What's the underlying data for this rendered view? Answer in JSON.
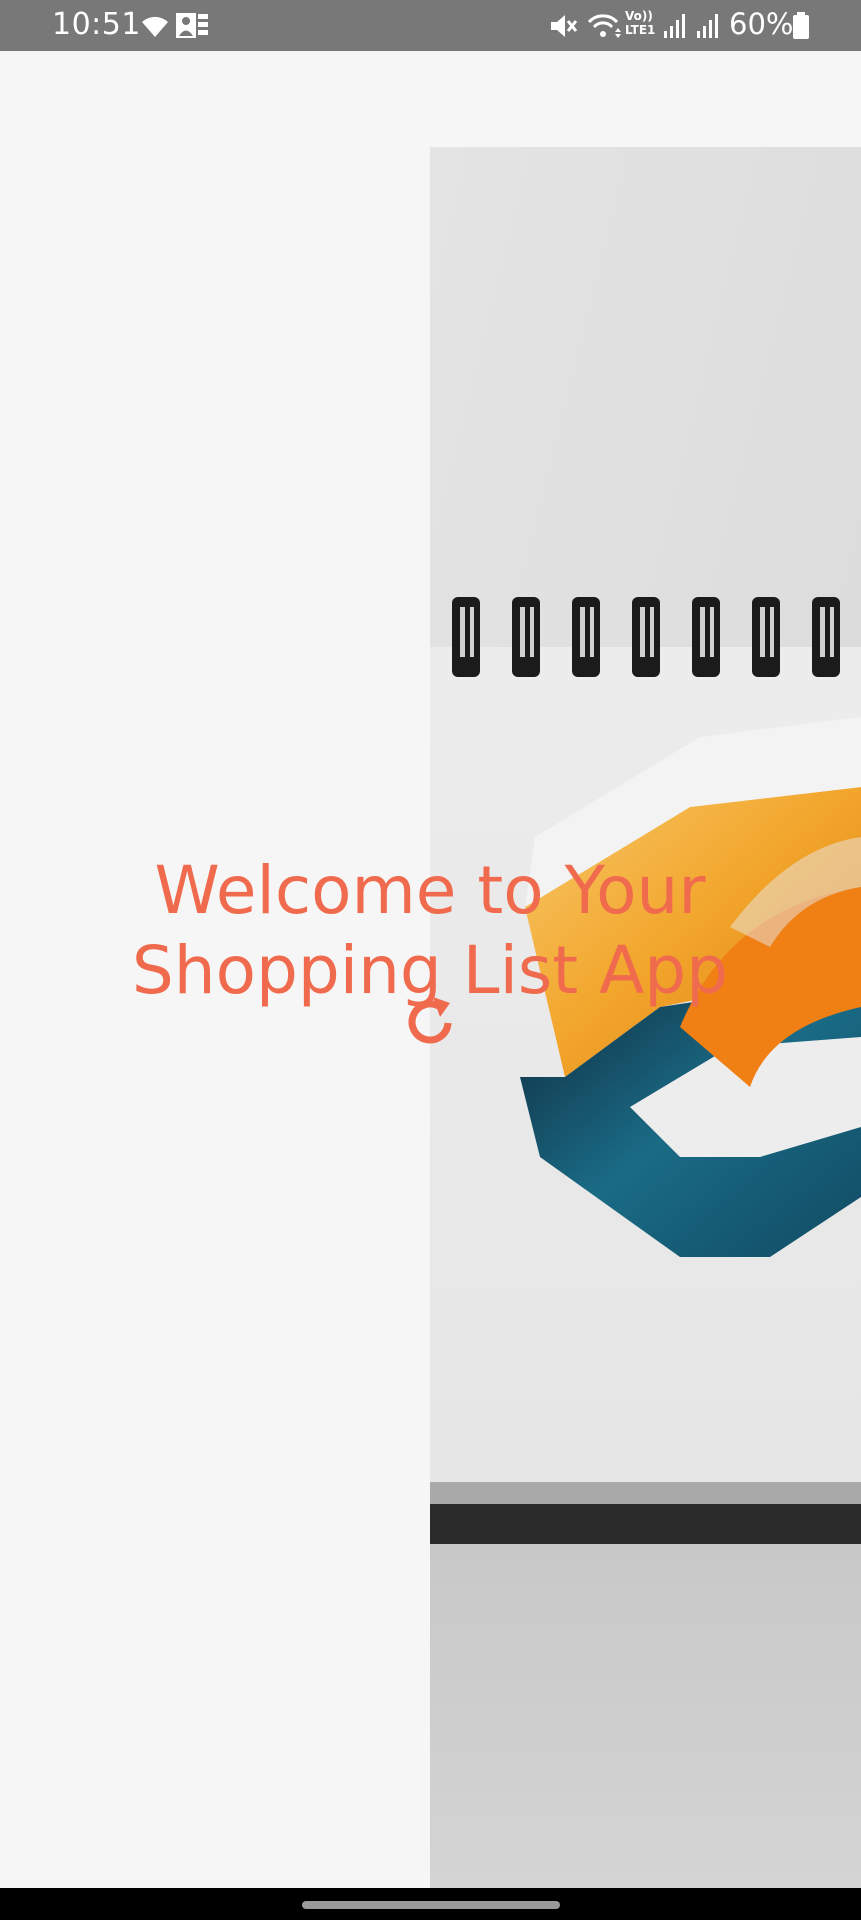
{
  "status_bar": {
    "time": "10:51",
    "battery": "60%",
    "left_icons": [
      "wifi-icon",
      "photo-gallery-icon"
    ],
    "right_icons": [
      "mute-icon",
      "wifi-icon",
      "volte-icon",
      "signal-icon",
      "signal-icon",
      "battery-icon"
    ],
    "volte_label_top": "Vo))",
    "volte_label_bottom": "LTE1"
  },
  "welcome": {
    "title": "Welcome to Your Shopping List App"
  },
  "colors": {
    "accent": "#f06a4d",
    "status_bar_bg": "#787878",
    "background": "#f6f6f6",
    "logo_orange": "#f28a1a",
    "logo_teal": "#1a6b86"
  },
  "icons": {
    "loading": "refresh-icon",
    "image": "notebook-logo-image"
  }
}
